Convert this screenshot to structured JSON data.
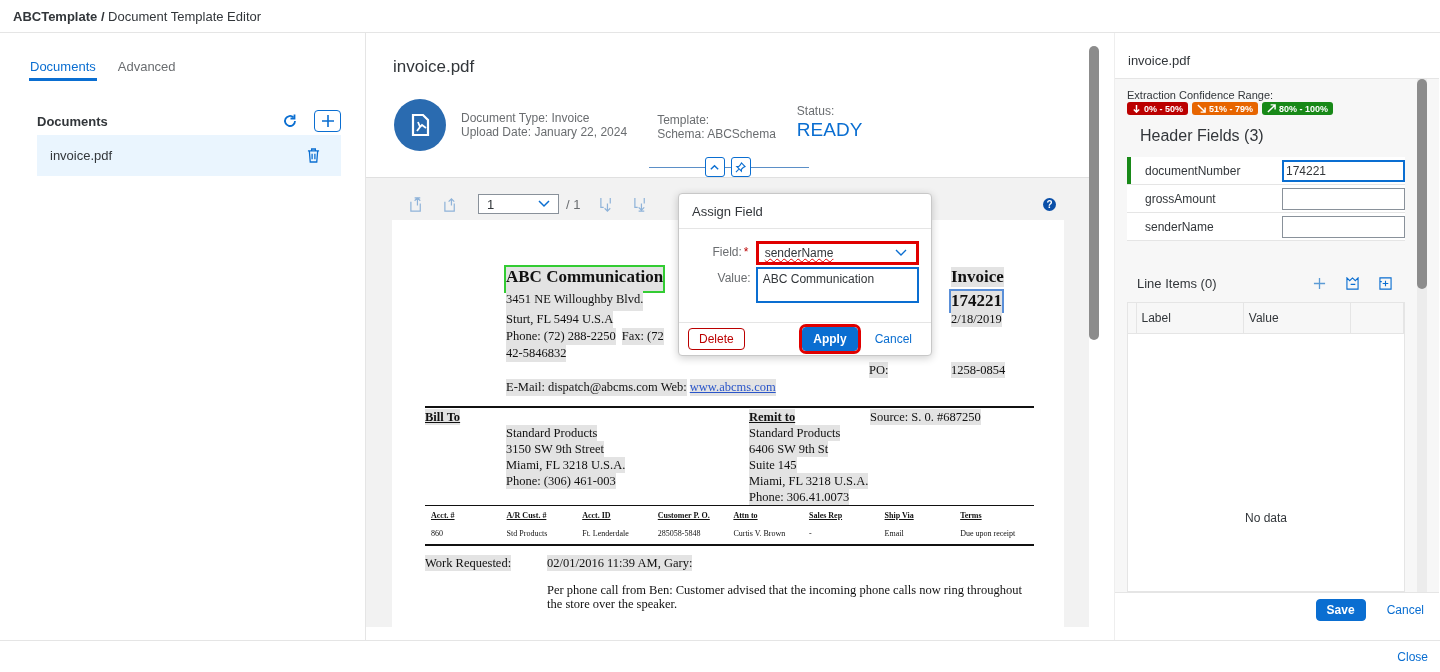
{
  "title": "**ABCTemplate /** Document Template Editor",
  "tabs": [
    {
      "label": "Documents",
      "selected": true
    },
    {
      "label": "Advanced",
      "selected": false
    }
  ],
  "documents": {
    "title": "Documents",
    "items": [
      {
        "name": "invoice.pdf",
        "selected": true
      }
    ]
  },
  "viewer": {
    "file": "invoice.pdf",
    "document_type": "Document Type: Invoice",
    "upload_date": "Upload Date: January 22, 2024",
    "template_label": "Template:",
    "schema": "Schema: ABCSchema",
    "status_label": "Status:",
    "status": "READY",
    "page": "1",
    "page_total": "/ 1",
    "help": "?"
  },
  "invoice": {
    "top_rows": [
      {
        "left": [
          {
            "text": "ABC Communication",
            "kind": "heading",
            "color": "#33cc33"
          }
        ],
        "right": [
          {
            "text": "Invoice",
            "kind": "heading"
          }
        ]
      },
      {
        "left": [
          {
            "text": "3451 NE Willoughby Blvd.",
            "kind": "text"
          }
        ],
        "right": [
          {
            "text": "174221",
            "kind": "heading",
            "color": "#5a8fd8"
          }
        ]
      },
      {
        "left": [
          {
            "text": "Sturt, FL 5494 U.S.A",
            "kind": "text"
          }
        ],
        "right": [
          {
            "text": "2/18/2019",
            "kind": "text"
          }
        ]
      },
      {
        "left": [
          {
            "text": "Phone: (72) 288-2250",
            "kind": "text"
          },
          {
            "text": "Fax: (72",
            "kind": "text"
          }
        ]
      },
      {
        "left": [
          {
            "text": "42-5846832",
            "kind": "text"
          }
        ]
      },
      {
        "middle": [
          {
            "text": "PO:",
            "kind": "text"
          }
        ],
        "right": [
          {
            "text": "1258-0854",
            "kind": "text"
          }
        ]
      },
      {
        "left": [
          {
            "text": "E-Mail: dispatch@abcms.com Web:",
            "kind": "text"
          },
          {
            "text": "www.abcms.com",
            "kind": "link"
          }
        ]
      }
    ],
    "bill_to": {
      "label": "Bill To",
      "lines": [
        "Standard Products",
        "3150 SW 9th Street",
        "Miami, FL 3218 U.S.A.",
        "Phone: (306) 461-003"
      ]
    },
    "remit_to": {
      "label": "Remit to",
      "lines": [
        "Standard Products",
        "6406 SW 9th St",
        "Suite 145",
        "Miami, FL 3218 U.S.A.",
        "Phone: 306.41.0073"
      ]
    },
    "source": "Source: S. 0. #687250",
    "table": {
      "columns": [
        "Acct. #",
        "A/R Cust. #",
        "Acct. ID",
        "Customer P. O.",
        "Attn to",
        "Sales Rep",
        "Ship Via",
        "Terms"
      ],
      "rows": [
        [
          "860",
          "Std Products",
          "Ft. Lenderdale",
          "285058-5848",
          "Curtis V. Brown",
          "-",
          "Email",
          "Due upon receipt"
        ]
      ]
    },
    "work": {
      "label": "Work Requested:",
      "date": "02/01/2016 11:39 AM, Gary:",
      "note": "Per phone call from Ben: Customer advised that the incoming phone calls now ring throughout the store over the speaker."
    }
  },
  "dialog": {
    "title": "Assign Field",
    "field_label": "Field:",
    "required_mark": "*",
    "field_value": "senderName",
    "field_highlighted": true,
    "value_label": "Value:",
    "value": "ABC Communication",
    "buttons": [
      {
        "label": "Delete",
        "kind": "reject",
        "highlighted": false
      },
      {
        "label": "Apply",
        "kind": "emphasized",
        "highlighted": true
      },
      {
        "label": "Cancel",
        "kind": "transparent",
        "highlighted": false
      }
    ]
  },
  "side": {
    "file": "invoice.pdf",
    "legend_label": "Extraction Confidence Range:",
    "legend": [
      {
        "label": "0% - 50%",
        "kind": "low",
        "color": "#bb0000"
      },
      {
        "label": "51% - 79%",
        "kind": "medium",
        "color": "#e76500"
      },
      {
        "label": "80% - 100%",
        "kind": "high",
        "color": "#188918"
      }
    ],
    "header_title": "Header Fields (3)",
    "fields": [
      {
        "label": "documentNumber",
        "value": "174221",
        "focused": true,
        "color": "#188918"
      },
      {
        "label": "grossAmount",
        "focused": false
      },
      {
        "label": "senderName",
        "focused": false
      }
    ],
    "line_items_title": "Line Items (0)",
    "columns": [
      "Label",
      "Value"
    ],
    "empty": "No data",
    "buttons": [
      {
        "label": "Save",
        "kind": "emphasized"
      },
      {
        "label": "Cancel",
        "kind": "transparent"
      }
    ]
  },
  "footer": {
    "close": "Close"
  }
}
